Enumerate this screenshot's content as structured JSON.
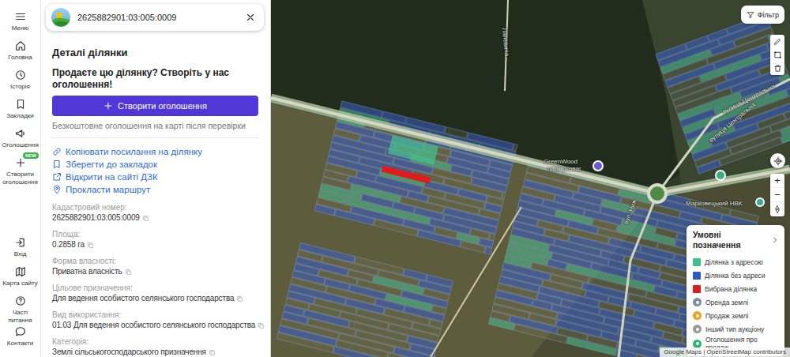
{
  "search": {
    "value": "2625882901:03:005:0009"
  },
  "nav": {
    "items": [
      {
        "label": "Меню"
      },
      {
        "label": "Головна"
      },
      {
        "label": "Історія"
      },
      {
        "label": "Закладки"
      },
      {
        "label": "Оголошення"
      },
      {
        "label": "Створити оголошення",
        "badge": "NEW"
      }
    ],
    "footer": [
      {
        "label": "Вхід"
      },
      {
        "label": "Карта сайту"
      },
      {
        "label": "Часті питання"
      },
      {
        "label": "Контакти"
      }
    ]
  },
  "panel": {
    "title": "Деталі ділянки",
    "promo": "Продаєте цю ділянку? Створіть у нас оголошення!",
    "create_button": "Створити оголошення",
    "note": "Безкоштовне оголошення на карті після перевірки",
    "links": [
      {
        "label": "Копіювати посилання на ділянку"
      },
      {
        "label": "Зберегти до закладок"
      },
      {
        "label": "Відкрити на сайті ДЗК"
      },
      {
        "label": "Прокласти маршрут"
      }
    ],
    "fields": [
      {
        "label": "Кадастровий номер:",
        "value": "2625882901:03:005:0009"
      },
      {
        "label": "Площа:",
        "value": "0.2858 га"
      },
      {
        "label": "Форма власності:",
        "value": "Приватна власність"
      },
      {
        "label": "Цільове призначення:",
        "value": "Для ведення особистого селянського господарства"
      },
      {
        "label": "Вид використання:",
        "value": "01.03 Для ведення особистого селянського господарства"
      },
      {
        "label": "Категорія:",
        "value": "Землі сільськогосподарського призначення"
      }
    ]
  },
  "map": {
    "filter_button": "Фільтр",
    "labels": [
      {
        "text": "GreenWood"
      },
      {
        "text": "парк розваг"
      },
      {
        "text": "вулиця Центральна"
      },
      {
        "text": "вулиця Центральна"
      },
      {
        "text": "Марковецький НВК"
      },
      {
        "text": "вул. Ниж"
      },
      {
        "text": "Ланевича"
      }
    ],
    "zoom_in": "+",
    "zoom_out": "−",
    "legend": {
      "title": "Умовні позначення",
      "items": [
        {
          "label": "Ділянка з адресою",
          "kind": "swatch",
          "color": "#3dbf8f"
        },
        {
          "label": "Ділянка без адреси",
          "kind": "swatch",
          "color": "#2b59c3"
        },
        {
          "label": "Вибрана ділянка",
          "kind": "swatch",
          "color": "#e01b1b"
        },
        {
          "label": "Оренда землі",
          "kind": "icon",
          "color": "#7f8fa6"
        },
        {
          "label": "Продаж землі",
          "kind": "icon",
          "color": "#f0a020"
        },
        {
          "label": "Інший тип аукціону",
          "kind": "icon",
          "color": "#9a9a9a"
        },
        {
          "label": "Оголошення про продаж",
          "kind": "icon",
          "color": "#2fb57a"
        }
      ]
    },
    "attribution": "Google Maps | OpenStreetMap contributors"
  }
}
